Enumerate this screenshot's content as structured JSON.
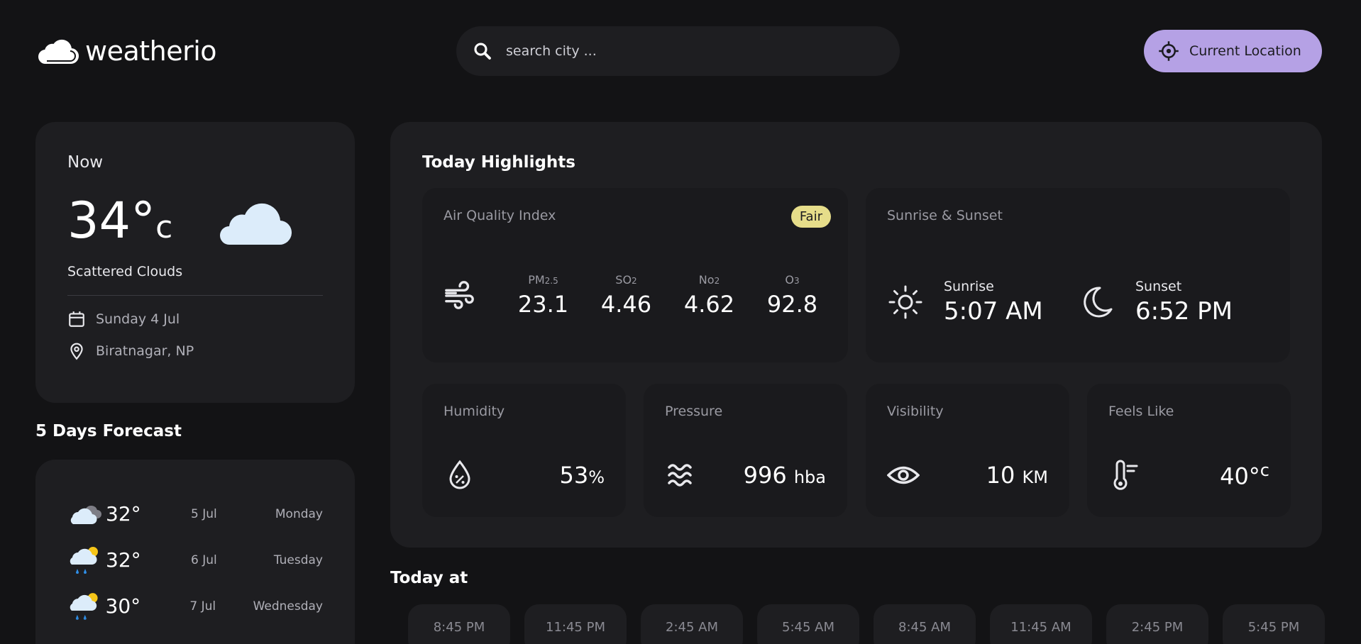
{
  "app": {
    "name": "weatherio"
  },
  "search": {
    "placeholder": "search city ..."
  },
  "location_button": {
    "label": "Current Location"
  },
  "now": {
    "label": "Now",
    "temp": "34°",
    "unit": "c",
    "description": "Scattered Clouds",
    "date": "Sunday 4 Jul",
    "location": "Biratnagar, NP"
  },
  "forecast": {
    "title": "5 Days Forecast",
    "items": [
      {
        "temp": "32°",
        "date": "5 Jul",
        "day": "Monday",
        "icon": "cloudy-icon"
      },
      {
        "temp": "32°",
        "date": "6 Jul",
        "day": "Tuesday",
        "icon": "rain-sun-icon"
      },
      {
        "temp": "30°",
        "date": "7 Jul",
        "day": "Wednesday",
        "icon": "rain-sun-icon"
      }
    ]
  },
  "highlights": {
    "title": "Today Highlights",
    "aqi": {
      "label": "Air Quality Index",
      "badge": "Fair",
      "items": [
        {
          "name": "PM",
          "sub": "2.5",
          "value": "23.1"
        },
        {
          "name": "SO",
          "sub": "2",
          "value": "4.46"
        },
        {
          "name": "No",
          "sub": "2",
          "value": "4.62"
        },
        {
          "name": "O",
          "sub": "3",
          "value": "92.8"
        }
      ]
    },
    "sun": {
      "label": "Sunrise & Sunset",
      "sunrise_label": "Sunrise",
      "sunrise": "5:07 AM",
      "sunset_label": "Sunset",
      "sunset": "6:52 PM"
    },
    "humidity": {
      "label": "Humidity",
      "value": "53",
      "unit": "%"
    },
    "pressure": {
      "label": "Pressure",
      "value": "996",
      "unit": "hba"
    },
    "visibility": {
      "label": "Visibility",
      "value": "10",
      "unit": "KM"
    },
    "feels_like": {
      "label": "Feels Like",
      "value": "40°",
      "unit": "c"
    }
  },
  "today": {
    "title": "Today at",
    "hours": [
      "8:45 PM",
      "11:45 PM",
      "2:45 AM",
      "5:45 AM",
      "8:45 AM",
      "11:45 AM",
      "2:45 PM",
      "5:45 PM"
    ]
  },
  "colors": {
    "background": "#131315",
    "card": "#1e1e21",
    "accent": "#b5a1e5",
    "badge": "#e6dd8a"
  }
}
